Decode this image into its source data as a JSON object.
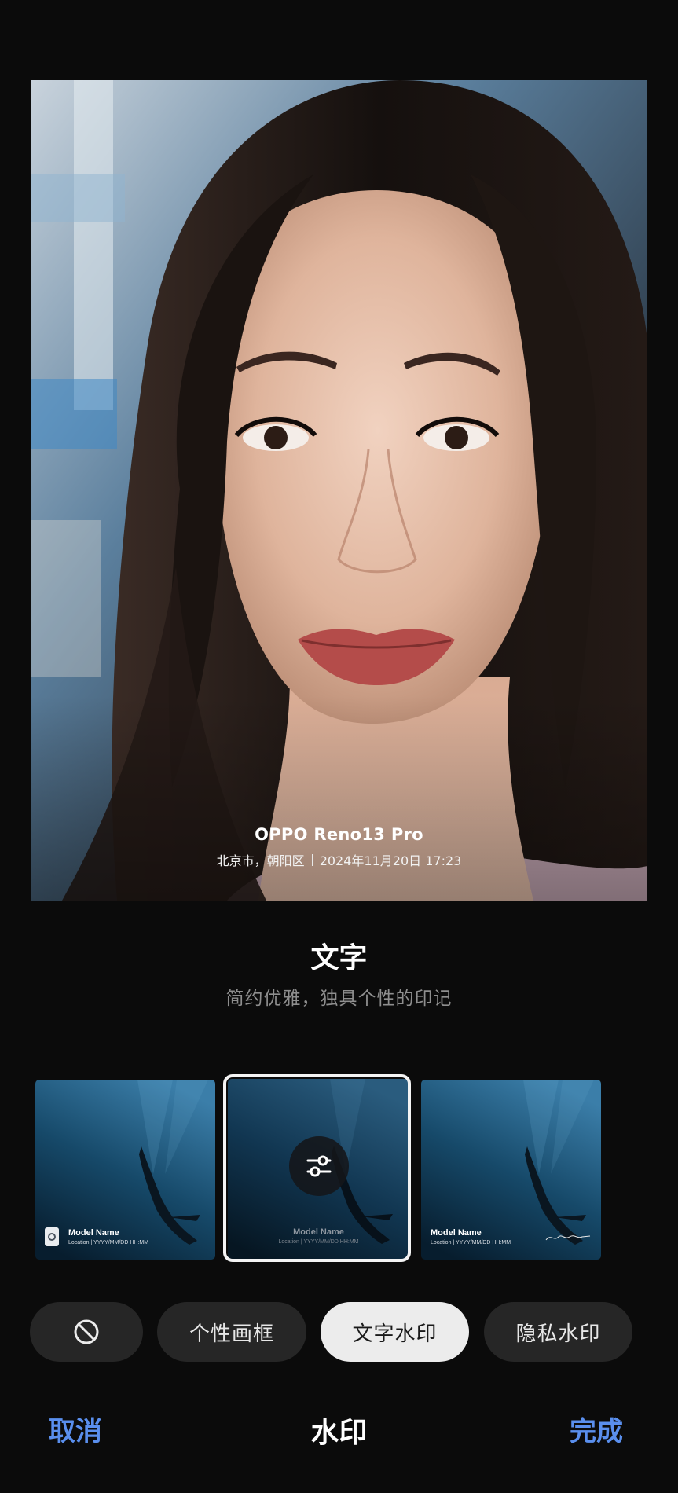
{
  "photo": {
    "watermark_model": "OPPO Reno13 Pro",
    "watermark_location": "北京市，朝阳区",
    "watermark_datetime": "2024年11月20日 17:23"
  },
  "style": {
    "title": "文字",
    "description": "简约优雅，独具个性的印记"
  },
  "thumbnails": [
    {
      "model": "Model Name",
      "meta": "Location  |  YYYY/MM/DD HH:MM",
      "selected": false
    },
    {
      "model": "Model Name",
      "meta": "Location  |  YYYY/MM/DD HH:MM",
      "selected": true
    },
    {
      "model": "Model Name",
      "meta": "Location  |  YYYY/MM/DD HH:MM",
      "selected": false
    }
  ],
  "categories": {
    "none_icon": "no-watermark-icon",
    "frame": "个性画框",
    "text": "文字水印",
    "privacy": "隐私水印",
    "selected": "文字水印"
  },
  "bottom_bar": {
    "cancel": "取消",
    "title": "水印",
    "done": "完成"
  },
  "colors": {
    "accent": "#5a8fee",
    "background": "#0b0b0b",
    "pill": "#262626",
    "pill_selected": "#ececec"
  }
}
